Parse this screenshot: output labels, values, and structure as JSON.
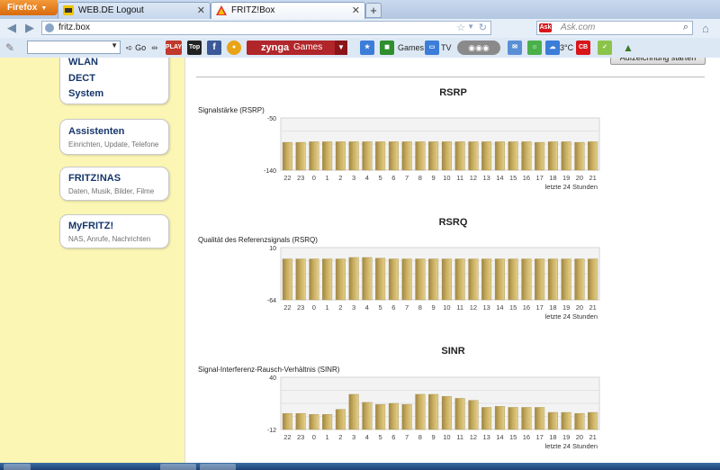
{
  "browser": {
    "menu_button": "Firefox",
    "tabs": [
      {
        "title": "WEB.DE Logout",
        "active": false
      },
      {
        "title": "FRITZ!Box",
        "active": true
      }
    ],
    "new_tab_label": "+",
    "url": "fritz.box",
    "search_placeholder": "Ask.com",
    "search_engine": "Ask"
  },
  "toolbar": {
    "go_label": "Go",
    "zynga_label": "zynga",
    "zynga_sub": "Games",
    "games_label": "Games",
    "tv_label": "TV",
    "weather": "3°C",
    "top100_label": "Top 100",
    "playvids_label": "PLAY VIDS",
    "cb_label": "CB"
  },
  "sidebar": {
    "top_items": [
      "WLAN",
      "DECT",
      "System"
    ],
    "cards": [
      {
        "title": "Assistenten",
        "subtitle": "Einrichten, Update, Telefone"
      },
      {
        "title": "FRITZ!NAS",
        "subtitle": "Daten, Musik, Bilder, Filme"
      },
      {
        "title": "MyFRITZ!",
        "subtitle": "NAS, Anrufe, Nachrichten"
      }
    ]
  },
  "panel": {
    "top_button": "Aufzeichnung starten"
  },
  "chart_data": [
    {
      "type": "bar",
      "title": "RSRP",
      "ylabel": "Signalstärke (RSRP)",
      "xlabel": "letzte 24 Stunden",
      "ylim": [
        -140,
        -50
      ],
      "categories": [
        "22",
        "23",
        "0",
        "1",
        "2",
        "3",
        "4",
        "5",
        "6",
        "7",
        "8",
        "9",
        "10",
        "11",
        "12",
        "13",
        "14",
        "15",
        "16",
        "17",
        "18",
        "19",
        "20",
        "21"
      ],
      "values": [
        -92,
        -92,
        -91,
        -91,
        -91,
        -91,
        -91,
        -91,
        -91,
        -91,
        -91,
        -91,
        -91,
        -91,
        -91,
        -91,
        -91,
        -91,
        -91,
        -92,
        -91,
        -91,
        -92,
        -91
      ],
      "grid": true
    },
    {
      "type": "bar",
      "title": "RSRQ",
      "ylabel": "Qualität des Referenzsignals (RSRQ)",
      "xlabel": "letzte 24 Stunden",
      "ylim": [
        -64,
        10
      ],
      "categories": [
        "22",
        "23",
        "0",
        "1",
        "2",
        "3",
        "4",
        "5",
        "6",
        "7",
        "8",
        "9",
        "10",
        "11",
        "12",
        "13",
        "14",
        "15",
        "16",
        "17",
        "18",
        "19",
        "20",
        "21"
      ],
      "values": [
        -6,
        -6,
        -6,
        -6,
        -6,
        -4,
        -4,
        -5,
        -6,
        -6,
        -6,
        -6,
        -6,
        -6,
        -6,
        -6,
        -6,
        -6,
        -6,
        -6,
        -6,
        -6,
        -6,
        -6
      ],
      "grid": true
    },
    {
      "type": "bar",
      "title": "SINR",
      "ylabel": "Signal-Interferenz-Rausch-Verhältnis (SINR)",
      "xlabel": "letzte 24 Stunden",
      "ylim": [
        -12,
        40
      ],
      "categories": [
        "22",
        "23",
        "0",
        "1",
        "2",
        "3",
        "4",
        "5",
        "6",
        "7",
        "8",
        "9",
        "10",
        "11",
        "12",
        "13",
        "14",
        "15",
        "16",
        "17",
        "18",
        "19",
        "20",
        "21"
      ],
      "values": [
        4,
        4,
        3,
        3,
        8,
        23,
        15,
        13,
        14,
        13,
        23,
        23,
        21,
        19,
        17,
        10,
        11,
        10,
        10,
        10,
        5,
        5,
        4,
        5
      ],
      "grid": true
    }
  ],
  "colors": {
    "page_bg": "#fbf6b4",
    "bar_fill": "#c8ad5e",
    "nav_text": "#15366b",
    "tab_bar": "#b3c7e1",
    "firefox_button": "#e27812"
  }
}
